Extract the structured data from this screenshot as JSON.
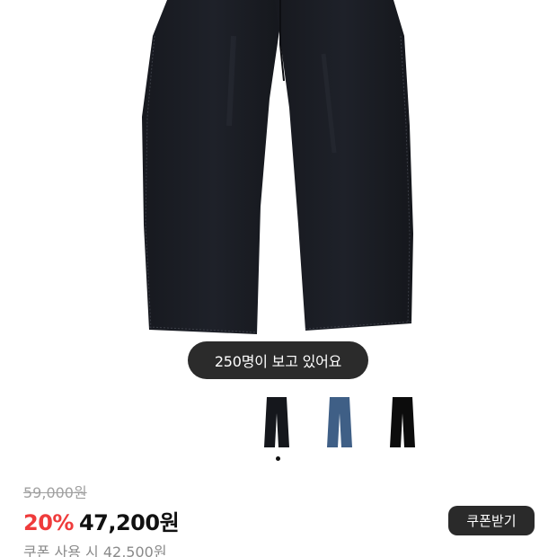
{
  "product": {
    "image_icon": "jeans-image",
    "viewers_text": "250명이 보고 있어요",
    "thumbnails": [
      {
        "name": "black-denim",
        "color": "#15171c"
      },
      {
        "name": "blue-denim",
        "color": "#3f5f86"
      },
      {
        "name": "solid-black",
        "color": "#0c0c0c"
      }
    ],
    "selected_thumbnail": 1
  },
  "pricing": {
    "original_price": "59,000원",
    "discount_rate": "20%",
    "sale_price": "47,200원",
    "coupon_price": "쿠폰 사용 시 42,500원",
    "coupon_button_label": "쿠폰받기"
  },
  "colors": {
    "discount": "#ef3b3b",
    "pill_bg": "#2b2b2b",
    "button_bg": "#2a2a2a"
  }
}
